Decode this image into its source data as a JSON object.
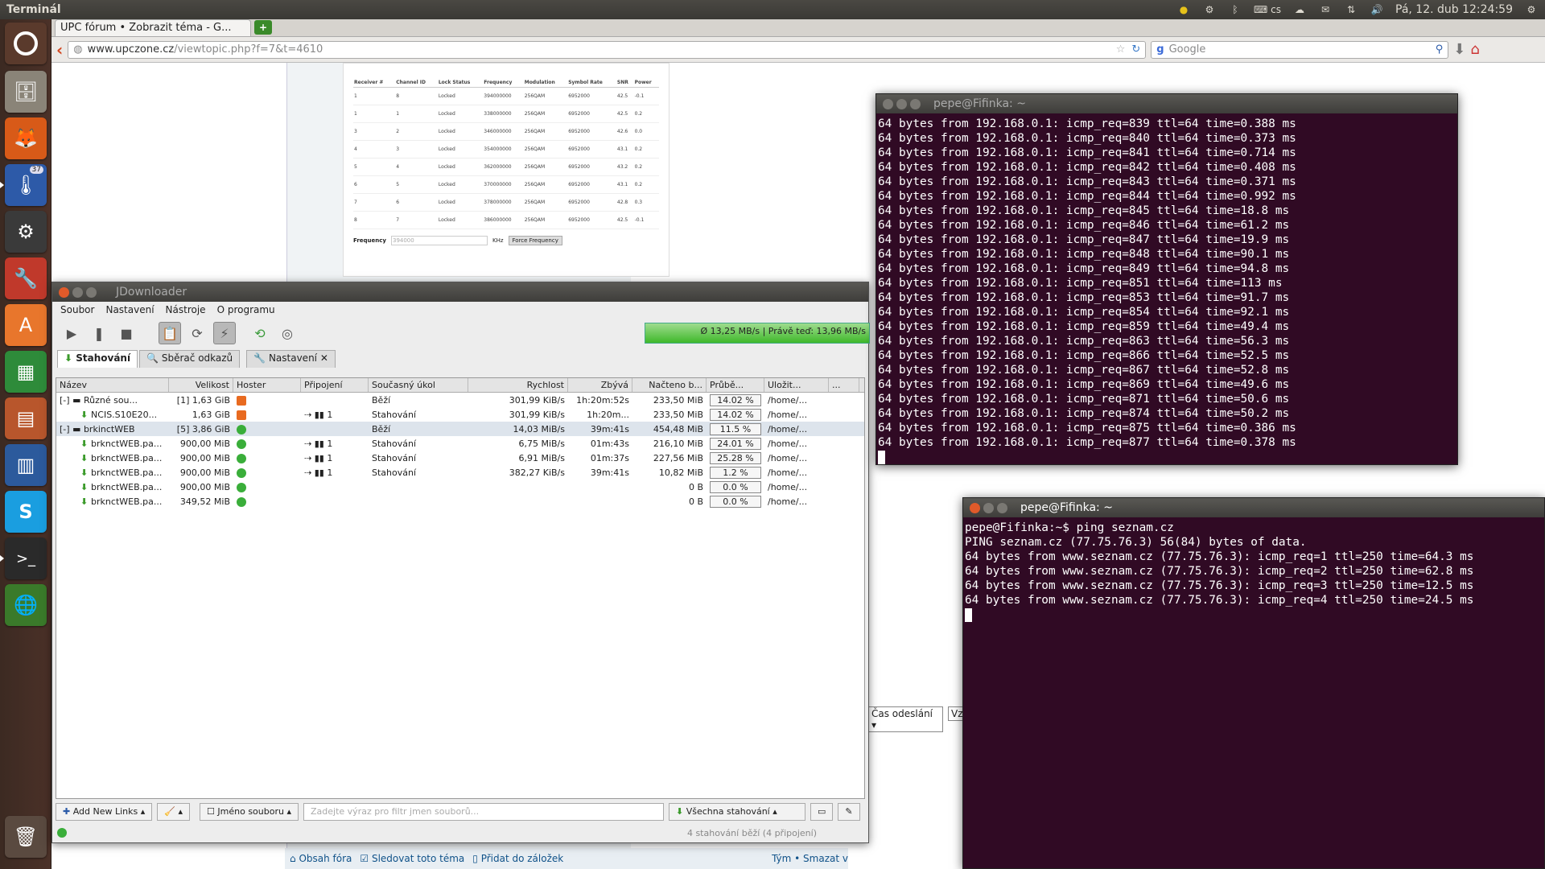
{
  "top_panel": {
    "app_title": "Terminál",
    "keyboard": "cs",
    "clock": "Pá, 12. dub 12:24:59"
  },
  "launcher": {
    "items": [
      "ubuntu-dash",
      "files",
      "firefox",
      "jdownloader",
      "steam",
      "system-settings",
      "software-center",
      "libreoffice-calc",
      "libreoffice-impress",
      "libreoffice-writer",
      "skype",
      "terminal",
      "jdownloader-2",
      "trash"
    ],
    "badge": "37"
  },
  "browser": {
    "tab_title": "UPC fórum • Zobrazit téma - G...",
    "url_domain": "www.upczone.cz",
    "url_path": "/viewtopic.php?f=7&t=4610",
    "search_placeholder": "Google",
    "modem_table": {
      "headers": [
        "Receiver #",
        "Channel ID",
        "Lock Status",
        "Frequency",
        "Modulation",
        "Symbol Rate",
        "SNR",
        "Power"
      ],
      "rows": [
        [
          "1",
          "8",
          "Locked",
          "394000000",
          "256QAM",
          "6952000",
          "42.5",
          "-0.1"
        ],
        [
          "1",
          "1",
          "Locked",
          "338000000",
          "256QAM",
          "6952000",
          "42.5",
          "0.2"
        ],
        [
          "3",
          "2",
          "Locked",
          "346000000",
          "256QAM",
          "6952000",
          "42.6",
          "0.0"
        ],
        [
          "4",
          "3",
          "Locked",
          "354000000",
          "256QAM",
          "6952000",
          "43.1",
          "0.2"
        ],
        [
          "5",
          "4",
          "Locked",
          "362000000",
          "256QAM",
          "6952000",
          "43.2",
          "0.2"
        ],
        [
          "6",
          "5",
          "Locked",
          "370000000",
          "256QAM",
          "6952000",
          "43.1",
          "0.2"
        ],
        [
          "7",
          "6",
          "Locked",
          "378000000",
          "256QAM",
          "6952000",
          "42.8",
          "0.3"
        ],
        [
          "8",
          "7",
          "Locked",
          "386000000",
          "256QAM",
          "6952000",
          "42.5",
          "-0.1"
        ]
      ],
      "frequency_label": "Frequency",
      "frequency_value": "394000",
      "unit": "KHz",
      "force_button": "Force Frequency"
    },
    "sort_select": "Čas odeslání",
    "sort_dir": "Vz",
    "footer": {
      "forum_index": "Obsah fóra",
      "watch_topic": "Sledovat toto téma",
      "bookmark": "Přidat do záložek",
      "right_text": "Tým • Smazat v"
    }
  },
  "jdownloader": {
    "title": "JDownloader",
    "menu": [
      "Soubor",
      "Nastavení",
      "Nástroje",
      "O programu"
    ],
    "speed_text": "Ø 13,25 MB/s | Právě teď: 13,96 MB/s",
    "tabs": [
      "Stahování",
      "Sběrač odkazů",
      "Nastavení"
    ],
    "columns": [
      "Název",
      "Velikost",
      "Hoster",
      "Připojení",
      "Současný úkol",
      "Rychlost",
      "Zbývá",
      "Načteno b...",
      "Průbě...",
      "Uložit...",
      "..."
    ],
    "rows": [
      {
        "type": "pkg",
        "name": "Různé sou...",
        "count": "[1]",
        "size": "1,63 GiB",
        "host": "orange",
        "conn": "",
        "task": "Běží",
        "speed": "301,99 KiB/s",
        "remaining": "1h:20m:52s",
        "loaded": "233,50 MiB",
        "progress": "14.02 %",
        "save": "/home/..."
      },
      {
        "type": "file",
        "name": "NCIS.S10E20...",
        "count": "",
        "size": "1,63 GiB",
        "host": "orange",
        "conn": "1",
        "task": "Stahování",
        "speed": "301,99 KiB/s",
        "remaining": "1h:20m...",
        "loaded": "233,50 MiB",
        "progress": "14.02 %",
        "save": "/home/..."
      },
      {
        "type": "pkg",
        "name": "brkinctWEB",
        "count": "[5]",
        "size": "3,86 GiB",
        "host": "green",
        "conn": "",
        "task": "Běží",
        "speed": "14,03 MiB/s",
        "remaining": "39m:41s",
        "loaded": "454,48 MiB",
        "progress": "11.5 %",
        "save": "/home/..."
      },
      {
        "type": "file",
        "name": "brknctWEB.pa...",
        "count": "",
        "size": "900,00 MiB",
        "host": "green",
        "conn": "1",
        "task": "Stahování",
        "speed": "6,75 MiB/s",
        "remaining": "01m:43s",
        "loaded": "216,10 MiB",
        "progress": "24.01 %",
        "save": "/home/..."
      },
      {
        "type": "file",
        "name": "brknctWEB.pa...",
        "count": "",
        "size": "900,00 MiB",
        "host": "green",
        "conn": "1",
        "task": "Stahování",
        "speed": "6,91 MiB/s",
        "remaining": "01m:37s",
        "loaded": "227,56 MiB",
        "progress": "25.28 %",
        "save": "/home/..."
      },
      {
        "type": "file",
        "name": "brknctWEB.pa...",
        "count": "",
        "size": "900,00 MiB",
        "host": "green",
        "conn": "1",
        "task": "Stahování",
        "speed": "382,27 KiB/s",
        "remaining": "39m:41s",
        "loaded": "10,82 MiB",
        "progress": "1.2 %",
        "save": "/home/..."
      },
      {
        "type": "file",
        "name": "brknctWEB.pa...",
        "count": "",
        "size": "900,00 MiB",
        "host": "green",
        "conn": "",
        "task": "",
        "speed": "",
        "remaining": "",
        "loaded": "0 B",
        "progress": "0.0 %",
        "save": "/home/..."
      },
      {
        "type": "file",
        "name": "brknctWEB.pa...",
        "count": "",
        "size": "349,52 MiB",
        "host": "green",
        "conn": "",
        "task": "",
        "speed": "",
        "remaining": "",
        "loaded": "0 B",
        "progress": "0.0 %",
        "save": "/home/..."
      }
    ],
    "add_links": "Add New Links",
    "filter_label": "Jméno souboru",
    "filter_placeholder": "Zadejte výraz pro filtr jmen souborů...",
    "all_downloads": "Všechna stahování",
    "status": "4 stahování běží (4 připojení)"
  },
  "terminal1": {
    "title": "pepe@Fifinka: ~",
    "lines": [
      "64 bytes from 192.168.0.1: icmp_req=839 ttl=64 time=0.388 ms",
      "64 bytes from 192.168.0.1: icmp_req=840 ttl=64 time=0.373 ms",
      "64 bytes from 192.168.0.1: icmp_req=841 ttl=64 time=0.714 ms",
      "64 bytes from 192.168.0.1: icmp_req=842 ttl=64 time=0.408 ms",
      "64 bytes from 192.168.0.1: icmp_req=843 ttl=64 time=0.371 ms",
      "64 bytes from 192.168.0.1: icmp_req=844 ttl=64 time=0.992 ms",
      "64 bytes from 192.168.0.1: icmp_req=845 ttl=64 time=18.8 ms",
      "64 bytes from 192.168.0.1: icmp_req=846 ttl=64 time=61.2 ms",
      "64 bytes from 192.168.0.1: icmp_req=847 ttl=64 time=19.9 ms",
      "64 bytes from 192.168.0.1: icmp_req=848 ttl=64 time=90.1 ms",
      "64 bytes from 192.168.0.1: icmp_req=849 ttl=64 time=94.8 ms",
      "64 bytes from 192.168.0.1: icmp_req=851 ttl=64 time=113 ms",
      "64 bytes from 192.168.0.1: icmp_req=853 ttl=64 time=91.7 ms",
      "64 bytes from 192.168.0.1: icmp_req=854 ttl=64 time=92.1 ms",
      "64 bytes from 192.168.0.1: icmp_req=859 ttl=64 time=49.4 ms",
      "64 bytes from 192.168.0.1: icmp_req=863 ttl=64 time=56.3 ms",
      "64 bytes from 192.168.0.1: icmp_req=866 ttl=64 time=52.5 ms",
      "64 bytes from 192.168.0.1: icmp_req=867 ttl=64 time=52.8 ms",
      "64 bytes from 192.168.0.1: icmp_req=869 ttl=64 time=49.6 ms",
      "64 bytes from 192.168.0.1: icmp_req=871 ttl=64 time=50.6 ms",
      "64 bytes from 192.168.0.1: icmp_req=874 ttl=64 time=50.2 ms",
      "64 bytes from 192.168.0.1: icmp_req=875 ttl=64 time=0.386 ms",
      "64 bytes from 192.168.0.1: icmp_req=877 ttl=64 time=0.378 ms"
    ]
  },
  "terminal2": {
    "title": "pepe@Fifinka: ~",
    "lines": [
      "pepe@Fifinka:~$ ping seznam.cz",
      "PING seznam.cz (77.75.76.3) 56(84) bytes of data.",
      "64 bytes from www.seznam.cz (77.75.76.3): icmp_req=1 ttl=250 time=64.3 ms",
      "64 bytes from www.seznam.cz (77.75.76.3): icmp_req=2 ttl=250 time=62.8 ms",
      "64 bytes from www.seznam.cz (77.75.76.3): icmp_req=3 ttl=250 time=12.5 ms",
      "64 bytes from www.seznam.cz (77.75.76.3): icmp_req=4 ttl=250 time=24.5 ms"
    ]
  }
}
